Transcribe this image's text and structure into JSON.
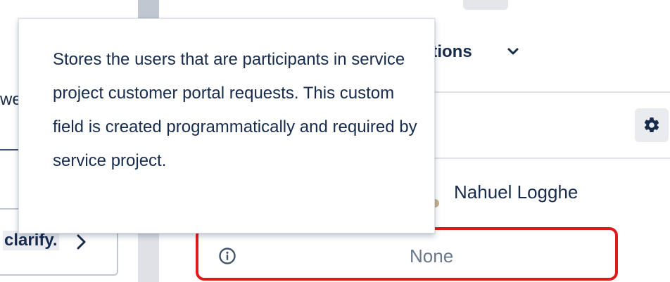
{
  "left_panel": {
    "partial_text": "we",
    "card": {
      "label": "clarify.",
      "chevron": "chevron-right-icon"
    }
  },
  "right_panel": {
    "actions_label": "ctions",
    "actions_chevron": "chevron-down-icon",
    "settings_icon": "gear-icon",
    "assignee_name": "Nahuel Logghe",
    "field": {
      "icon": "info-icon",
      "value": "None",
      "highlight_color": "#de1a1a"
    }
  },
  "tooltip": {
    "text": "Stores the users that are participants in service project customer portal requests. This custom field is created programmatically and required by service project."
  }
}
